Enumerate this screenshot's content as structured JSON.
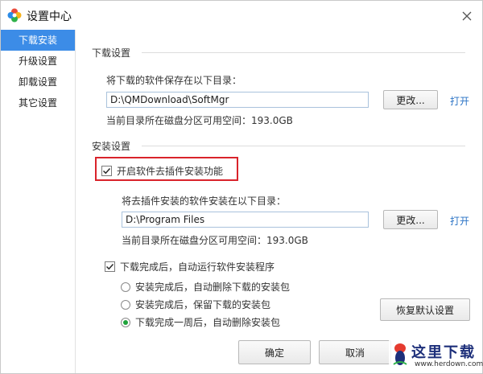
{
  "window": {
    "title": "设置中心"
  },
  "sidebar": {
    "items": [
      {
        "label": "下载安装",
        "active": true
      },
      {
        "label": "升级设置",
        "active": false
      },
      {
        "label": "卸载设置",
        "active": false
      },
      {
        "label": "其它设置",
        "active": false
      }
    ]
  },
  "download": {
    "section_title": "下载设置",
    "dir_label": "将下载的软件保存在以下目录：",
    "dir_value": "D:\\QMDownload\\SoftMgr",
    "change_button": "更改...",
    "open_link": "打开",
    "space_text": "当前目录所在磁盘分区可用空间：193.0GB"
  },
  "install": {
    "section_title": "安装设置",
    "plugin_checkbox_label": "开启软件去插件安装功能",
    "plugin_checked": true,
    "dir_label": "将去插件安装的软件安装在以下目录：",
    "dir_value": "D:\\Program Files",
    "change_button": "更改...",
    "open_link": "打开",
    "space_text": "当前目录所在磁盘分区可用空间：193.0GB",
    "auto_run_label": "下载完成后，自动运行软件安装程序",
    "auto_run_checked": true,
    "radios": [
      {
        "label": "安装完成后，自动删除下载的安装包",
        "checked": false
      },
      {
        "label": "安装完成后，保留下载的安装包",
        "checked": false
      },
      {
        "label": "下载完成一周后，自动删除安装包",
        "checked": true
      }
    ],
    "restore_button": "恢复默认设置"
  },
  "footer": {
    "ok_button": "确定",
    "cancel_button": "取消"
  },
  "watermark": {
    "text": "这里下载",
    "url": "www.herdown.com"
  },
  "colors": {
    "accent": "#3c8ce7",
    "link": "#2c74c6",
    "highlight": "#d9232b",
    "radio_selected": "#1fa33b"
  },
  "icons": {
    "app": "colorful-flower-icon",
    "close": "close-icon",
    "check": "check-icon"
  }
}
